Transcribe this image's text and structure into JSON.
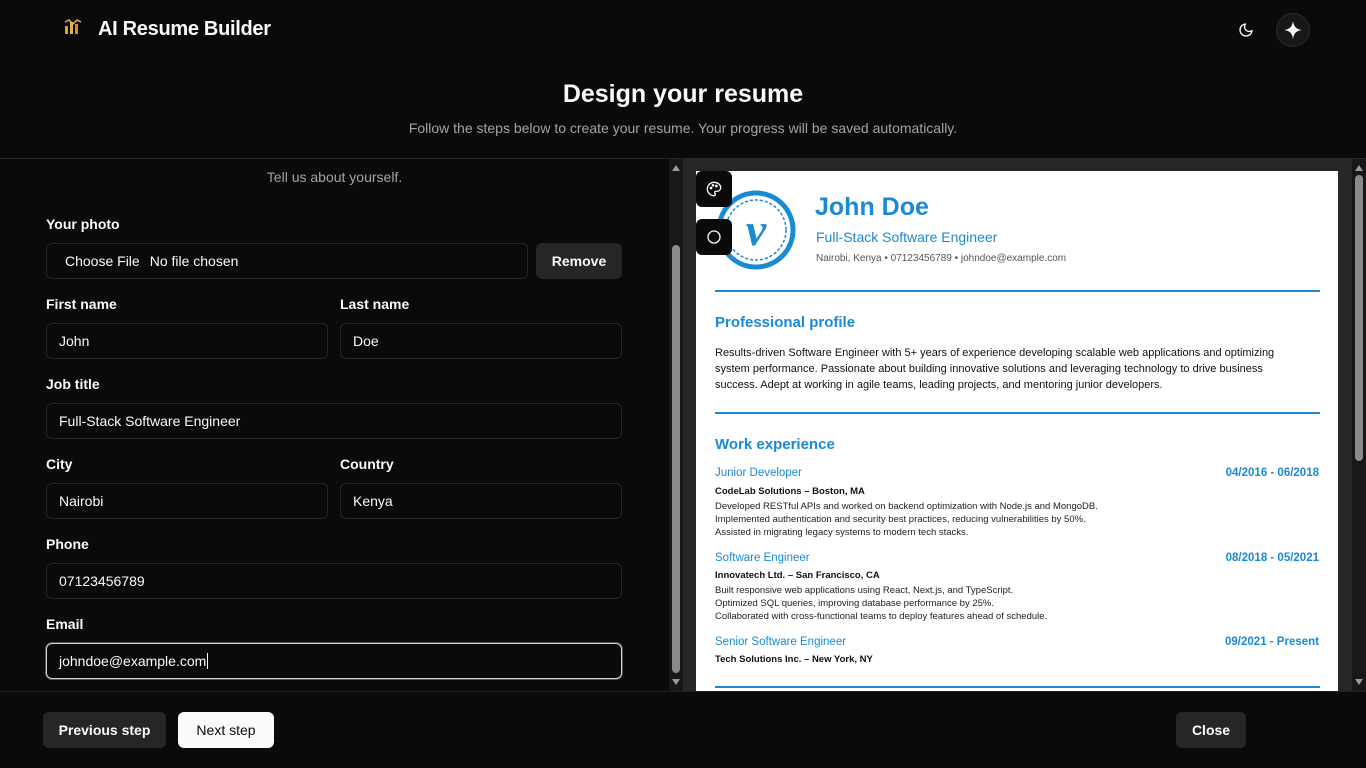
{
  "app": {
    "title": "AI Resume Builder"
  },
  "page": {
    "heading": "Design your resume",
    "subheading": "Follow the steps below to create your resume. Your progress will be saved automatically."
  },
  "form": {
    "prompt": "Tell us about yourself.",
    "photo": {
      "label": "Your photo",
      "choose_label": "Choose File",
      "status": "No file chosen",
      "remove_label": "Remove"
    },
    "first_name": {
      "label": "First name",
      "value": "John"
    },
    "last_name": {
      "label": "Last name",
      "value": "Doe"
    },
    "job_title": {
      "label": "Job title",
      "value": "Full-Stack Software Engineer"
    },
    "city": {
      "label": "City",
      "value": "Nairobi"
    },
    "country": {
      "label": "Country",
      "value": "Kenya"
    },
    "phone": {
      "label": "Phone",
      "value": "07123456789"
    },
    "email": {
      "label": "Email",
      "value": "johndoe@example.com"
    }
  },
  "preview": {
    "name": "John Doe",
    "job_title": "Full-Stack Software Engineer",
    "contact": "Nairobi, Kenya • 07123456789 • johndoe@example.com",
    "accent_color": "#1a8ad4",
    "profile_heading": "Professional profile",
    "summary": "Results-driven Software Engineer with 5+ years of experience developing scalable web applications and optimizing system performance. Passionate about building innovative solutions and leveraging technology to drive business success. Adept at working in agile teams, leading projects, and mentoring junior developers.",
    "work_heading": "Work experience",
    "jobs": [
      {
        "title": "Junior Developer",
        "dates": "04/2016 - 06/2018",
        "company": "CodeLab Solutions – Boston, MA",
        "lines": [
          "Developed RESTful APIs and worked on backend optimization with Node.js and MongoDB.",
          "Implemented authentication and security best practices, reducing vulnerabilities by 50%.",
          "Assisted in migrating legacy systems to modern tech stacks."
        ]
      },
      {
        "title": "Software Engineer",
        "dates": "08/2018 - 05/2021",
        "company": "Innovatech Ltd. – San Francisco, CA",
        "lines": [
          "Built responsive web applications using React, Next.js, and TypeScript.",
          "Optimized SQL queries, improving database performance by 25%.",
          "Collaborated with cross-functional teams to deploy features ahead of schedule."
        ]
      },
      {
        "title": "Senior Software Engineer",
        "dates": "09/2021 - Present",
        "company": "Tech Solutions Inc. – New York, NY",
        "lines": []
      }
    ]
  },
  "footer": {
    "prev_label": "Previous step",
    "next_label": "Next step",
    "close_label": "Close"
  },
  "icons": {
    "logo": "logo-icon",
    "theme": "moon-icon",
    "assistant": "sparkle-icon",
    "palette": "palette-icon",
    "shape": "circle-icon"
  }
}
